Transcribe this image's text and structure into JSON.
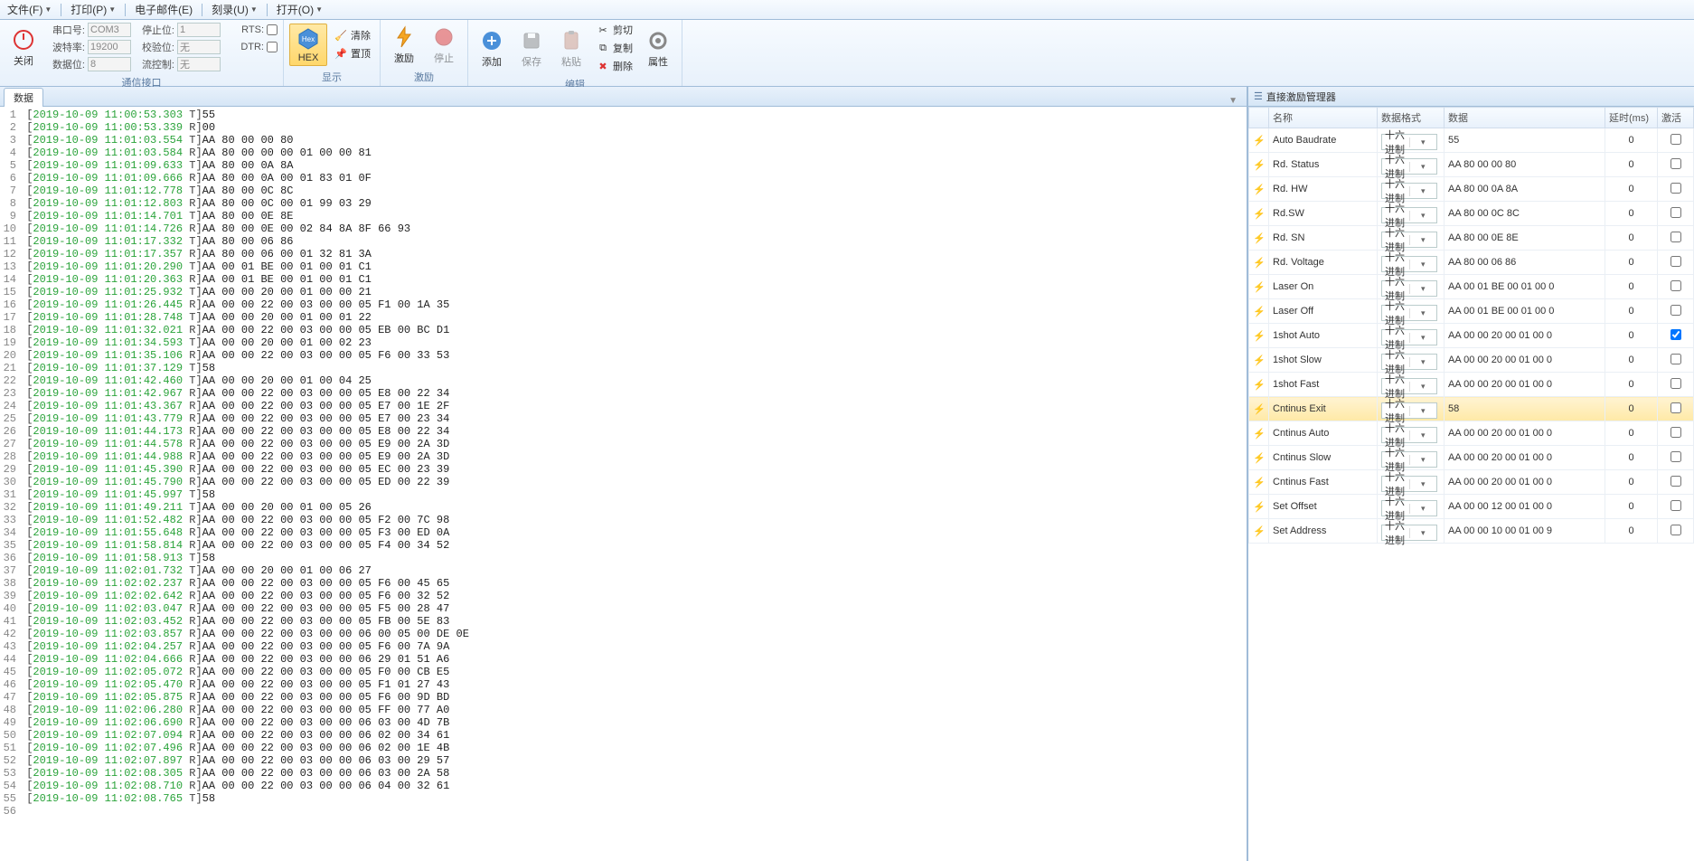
{
  "menus": {
    "file": "文件(F)",
    "print": "打印(P)",
    "email": "电子邮件(E)",
    "burn": "刻录(U)",
    "open": "打开(O)"
  },
  "ribbon": {
    "section_comm_label": "通信接口",
    "section_disp_label": "显示",
    "section_stim_label": "激励",
    "section_edit_label": "编辑",
    "close_btn": "关闭",
    "port_label": "串口号:",
    "port_value": "COM3",
    "baud_label": "波特率:",
    "baud_value": "19200",
    "databits_label": "数据位:",
    "databits_value": "8",
    "stopbits_label": "停止位:",
    "stopbits_value": "1",
    "parity_label": "校验位:",
    "parity_value": "无",
    "flow_label": "流控制:",
    "flow_value": "无",
    "rts_label": "RTS:",
    "dtr_label": "DTR:",
    "hex_btn": "HEX",
    "top_btn": "置顶",
    "clear_btn": "清除",
    "stim_btn": "激励",
    "stop_btn": "停止",
    "add_btn": "添加",
    "save_btn": "保存",
    "paste_btn": "粘贴",
    "cut_btn": "剪切",
    "copy_btn": "复制",
    "delete_btn": "删除",
    "prop_btn": "属性"
  },
  "tabs": {
    "data_tab": "数据"
  },
  "right_panel": {
    "title": "直接激励管理器",
    "col_name": "名称",
    "col_format": "数据格式",
    "col_data": "数据",
    "col_delay": "延时(ms)",
    "col_active": "激活"
  },
  "stimuli": [
    {
      "name": "Auto Baudrate",
      "fmt": "十六进制",
      "data": "55",
      "delay": "0",
      "active": false,
      "sel": false
    },
    {
      "name": "Rd. Status",
      "fmt": "十六进制",
      "data": "AA 80 00 00 80",
      "delay": "0",
      "active": false,
      "sel": false
    },
    {
      "name": "Rd. HW",
      "fmt": "十六进制",
      "data": "AA 80 00 0A 8A",
      "delay": "0",
      "active": false,
      "sel": false
    },
    {
      "name": "Rd.SW",
      "fmt": "十六进制",
      "data": "AA 80 00 0C 8C",
      "delay": "0",
      "active": false,
      "sel": false
    },
    {
      "name": "Rd. SN",
      "fmt": "十六进制",
      "data": "AA 80 00 0E 8E",
      "delay": "0",
      "active": false,
      "sel": false
    },
    {
      "name": "Rd. Voltage",
      "fmt": "十六进制",
      "data": "AA 80 00 06 86",
      "delay": "0",
      "active": false,
      "sel": false
    },
    {
      "name": "Laser On",
      "fmt": "十六进制",
      "data": "AA 00 01 BE 00 01 00 0",
      "delay": "0",
      "active": false,
      "sel": false
    },
    {
      "name": "Laser Off",
      "fmt": "十六进制",
      "data": "AA 00 01 BE 00 01 00 0",
      "delay": "0",
      "active": false,
      "sel": false
    },
    {
      "name": "1shot Auto",
      "fmt": "十六进制",
      "data": "AA 00 00 20 00 01 00 0",
      "delay": "0",
      "active": true,
      "sel": false
    },
    {
      "name": "1shot Slow",
      "fmt": "十六进制",
      "data": "AA 00 00 20 00 01 00 0",
      "delay": "0",
      "active": false,
      "sel": false
    },
    {
      "name": "1shot Fast",
      "fmt": "十六进制",
      "data": "AA 00 00 20 00 01 00 0",
      "delay": "0",
      "active": false,
      "sel": false
    },
    {
      "name": "Cntinus Exit",
      "fmt": "十六进制",
      "data": "58",
      "delay": "0",
      "active": false,
      "sel": true
    },
    {
      "name": "Cntinus Auto",
      "fmt": "十六进制",
      "data": "AA 00 00 20 00 01 00 0",
      "delay": "0",
      "active": false,
      "sel": false
    },
    {
      "name": "Cntinus Slow",
      "fmt": "十六进制",
      "data": "AA 00 00 20 00 01 00 0",
      "delay": "0",
      "active": false,
      "sel": false
    },
    {
      "name": "Cntinus Fast",
      "fmt": "十六进制",
      "data": "AA 00 00 20 00 01 00 0",
      "delay": "0",
      "active": false,
      "sel": false
    },
    {
      "name": "Set Offset",
      "fmt": "十六进制",
      "data": "AA 00 00 12 00 01 00 0",
      "delay": "0",
      "active": false,
      "sel": false
    },
    {
      "name": "Set Address",
      "fmt": "十六进制",
      "data": "AA 00 00 10 00 01 00 9",
      "delay": "0",
      "active": false,
      "sel": false
    }
  ],
  "log": [
    {
      "n": 1,
      "ts": "2019-10-09 11:00:53.303",
      "d": "T",
      "p": "55"
    },
    {
      "n": 2,
      "ts": "2019-10-09 11:00:53.339",
      "d": "R",
      "p": "00"
    },
    {
      "n": 3,
      "ts": "2019-10-09 11:01:03.554",
      "d": "T",
      "p": "AA 80 00 00 80"
    },
    {
      "n": 4,
      "ts": "2019-10-09 11:01:03.584",
      "d": "R",
      "p": "AA 80 00 00 00 01 00 00 81"
    },
    {
      "n": 5,
      "ts": "2019-10-09 11:01:09.633",
      "d": "T",
      "p": "AA 80 00 0A 8A"
    },
    {
      "n": 6,
      "ts": "2019-10-09 11:01:09.666",
      "d": "R",
      "p": "AA 80 00 0A 00 01 83 01 0F"
    },
    {
      "n": 7,
      "ts": "2019-10-09 11:01:12.778",
      "d": "T",
      "p": "AA 80 00 0C 8C"
    },
    {
      "n": 8,
      "ts": "2019-10-09 11:01:12.803",
      "d": "R",
      "p": "AA 80 00 0C 00 01 99 03 29"
    },
    {
      "n": 9,
      "ts": "2019-10-09 11:01:14.701",
      "d": "T",
      "p": "AA 80 00 0E 8E"
    },
    {
      "n": 10,
      "ts": "2019-10-09 11:01:14.726",
      "d": "R",
      "p": "AA 80 00 0E 00 02 84 8A 8F 66 93"
    },
    {
      "n": 11,
      "ts": "2019-10-09 11:01:17.332",
      "d": "T",
      "p": "AA 80 00 06 86"
    },
    {
      "n": 12,
      "ts": "2019-10-09 11:01:17.357",
      "d": "R",
      "p": "AA 80 00 06 00 01 32 81 3A"
    },
    {
      "n": 13,
      "ts": "2019-10-09 11:01:20.290",
      "d": "T",
      "p": "AA 00 01 BE 00 01 00 01 C1"
    },
    {
      "n": 14,
      "ts": "2019-10-09 11:01:20.363",
      "d": "R",
      "p": "AA 00 01 BE 00 01 00 01 C1"
    },
    {
      "n": 15,
      "ts": "2019-10-09 11:01:25.932",
      "d": "T",
      "p": "AA 00 00 20 00 01 00 00 21"
    },
    {
      "n": 16,
      "ts": "2019-10-09 11:01:26.445",
      "d": "R",
      "p": "AA 00 00 22 00 03 00 00 05 F1 00 1A 35"
    },
    {
      "n": 17,
      "ts": "2019-10-09 11:01:28.748",
      "d": "T",
      "p": "AA 00 00 20 00 01 00 01 22"
    },
    {
      "n": 18,
      "ts": "2019-10-09 11:01:32.021",
      "d": "R",
      "p": "AA 00 00 22 00 03 00 00 05 EB 00 BC D1"
    },
    {
      "n": 19,
      "ts": "2019-10-09 11:01:34.593",
      "d": "T",
      "p": "AA 00 00 20 00 01 00 02 23"
    },
    {
      "n": 20,
      "ts": "2019-10-09 11:01:35.106",
      "d": "R",
      "p": "AA 00 00 22 00 03 00 00 05 F6 00 33 53"
    },
    {
      "n": 21,
      "ts": "2019-10-09 11:01:37.129",
      "d": "T",
      "p": "58"
    },
    {
      "n": 22,
      "ts": "2019-10-09 11:01:42.460",
      "d": "T",
      "p": "AA 00 00 20 00 01 00 04 25"
    },
    {
      "n": 23,
      "ts": "2019-10-09 11:01:42.967",
      "d": "R",
      "p": "AA 00 00 22 00 03 00 00 05 E8 00 22 34"
    },
    {
      "n": 24,
      "ts": "2019-10-09 11:01:43.367",
      "d": "R",
      "p": "AA 00 00 22 00 03 00 00 05 E7 00 1E 2F"
    },
    {
      "n": 25,
      "ts": "2019-10-09 11:01:43.779",
      "d": "R",
      "p": "AA 00 00 22 00 03 00 00 05 E7 00 23 34"
    },
    {
      "n": 26,
      "ts": "2019-10-09 11:01:44.173",
      "d": "R",
      "p": "AA 00 00 22 00 03 00 00 05 E8 00 22 34"
    },
    {
      "n": 27,
      "ts": "2019-10-09 11:01:44.578",
      "d": "R",
      "p": "AA 00 00 22 00 03 00 00 05 E9 00 2A 3D"
    },
    {
      "n": 28,
      "ts": "2019-10-09 11:01:44.988",
      "d": "R",
      "p": "AA 00 00 22 00 03 00 00 05 E9 00 2A 3D"
    },
    {
      "n": 29,
      "ts": "2019-10-09 11:01:45.390",
      "d": "R",
      "p": "AA 00 00 22 00 03 00 00 05 EC 00 23 39"
    },
    {
      "n": 30,
      "ts": "2019-10-09 11:01:45.790",
      "d": "R",
      "p": "AA 00 00 22 00 03 00 00 05 ED 00 22 39"
    },
    {
      "n": 31,
      "ts": "2019-10-09 11:01:45.997",
      "d": "T",
      "p": "58"
    },
    {
      "n": 32,
      "ts": "2019-10-09 11:01:49.211",
      "d": "T",
      "p": "AA 00 00 20 00 01 00 05 26"
    },
    {
      "n": 33,
      "ts": "2019-10-09 11:01:52.482",
      "d": "R",
      "p": "AA 00 00 22 00 03 00 00 05 F2 00 7C 98"
    },
    {
      "n": 34,
      "ts": "2019-10-09 11:01:55.648",
      "d": "R",
      "p": "AA 00 00 22 00 03 00 00 05 F3 00 ED 0A"
    },
    {
      "n": 35,
      "ts": "2019-10-09 11:01:58.814",
      "d": "R",
      "p": "AA 00 00 22 00 03 00 00 05 F4 00 34 52"
    },
    {
      "n": 36,
      "ts": "2019-10-09 11:01:58.913",
      "d": "T",
      "p": "58"
    },
    {
      "n": 37,
      "ts": "2019-10-09 11:02:01.732",
      "d": "T",
      "p": "AA 00 00 20 00 01 00 06 27"
    },
    {
      "n": 38,
      "ts": "2019-10-09 11:02:02.237",
      "d": "R",
      "p": "AA 00 00 22 00 03 00 00 05 F6 00 45 65"
    },
    {
      "n": 39,
      "ts": "2019-10-09 11:02:02.642",
      "d": "R",
      "p": "AA 00 00 22 00 03 00 00 05 F6 00 32 52"
    },
    {
      "n": 40,
      "ts": "2019-10-09 11:02:03.047",
      "d": "R",
      "p": "AA 00 00 22 00 03 00 00 05 F5 00 28 47"
    },
    {
      "n": 41,
      "ts": "2019-10-09 11:02:03.452",
      "d": "R",
      "p": "AA 00 00 22 00 03 00 00 05 FB 00 5E 83"
    },
    {
      "n": 42,
      "ts": "2019-10-09 11:02:03.857",
      "d": "R",
      "p": "AA 00 00 22 00 03 00 00 06 00 05 00 DE 0E"
    },
    {
      "n": 43,
      "ts": "2019-10-09 11:02:04.257",
      "d": "R",
      "p": "AA 00 00 22 00 03 00 00 05 F6 00 7A 9A"
    },
    {
      "n": 44,
      "ts": "2019-10-09 11:02:04.666",
      "d": "R",
      "p": "AA 00 00 22 00 03 00 00 06 29 01 51 A6"
    },
    {
      "n": 45,
      "ts": "2019-10-09 11:02:05.072",
      "d": "R",
      "p": "AA 00 00 22 00 03 00 00 05 F0 00 CB E5"
    },
    {
      "n": 46,
      "ts": "2019-10-09 11:02:05.470",
      "d": "R",
      "p": "AA 00 00 22 00 03 00 00 05 F1 01 27 43"
    },
    {
      "n": 47,
      "ts": "2019-10-09 11:02:05.875",
      "d": "R",
      "p": "AA 00 00 22 00 03 00 00 05 F6 00 9D BD"
    },
    {
      "n": 48,
      "ts": "2019-10-09 11:02:06.280",
      "d": "R",
      "p": "AA 00 00 22 00 03 00 00 05 FF 00 77 A0"
    },
    {
      "n": 49,
      "ts": "2019-10-09 11:02:06.690",
      "d": "R",
      "p": "AA 00 00 22 00 03 00 00 06 03 00 4D 7B"
    },
    {
      "n": 50,
      "ts": "2019-10-09 11:02:07.094",
      "d": "R",
      "p": "AA 00 00 22 00 03 00 00 06 02 00 34 61"
    },
    {
      "n": 51,
      "ts": "2019-10-09 11:02:07.496",
      "d": "R",
      "p": "AA 00 00 22 00 03 00 00 06 02 00 1E 4B"
    },
    {
      "n": 52,
      "ts": "2019-10-09 11:02:07.897",
      "d": "R",
      "p": "AA 00 00 22 00 03 00 00 06 03 00 29 57"
    },
    {
      "n": 53,
      "ts": "2019-10-09 11:02:08.305",
      "d": "R",
      "p": "AA 00 00 22 00 03 00 00 06 03 00 2A 58"
    },
    {
      "n": 54,
      "ts": "2019-10-09 11:02:08.710",
      "d": "R",
      "p": "AA 00 00 22 00 03 00 00 06 04 00 32 61"
    },
    {
      "n": 55,
      "ts": "2019-10-09 11:02:08.765",
      "d": "T",
      "p": "58"
    },
    {
      "n": 56,
      "ts": "",
      "d": "",
      "p": ""
    }
  ]
}
